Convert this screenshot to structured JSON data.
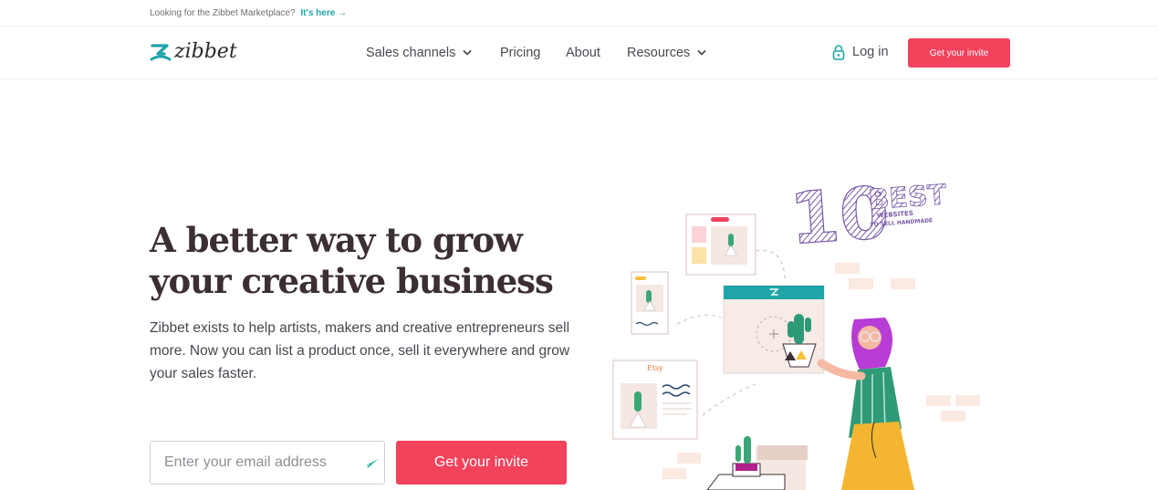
{
  "topbar": {
    "message": "Looking for the Zibbet Marketplace?",
    "link_label": "It's here →"
  },
  "header": {
    "logo_text": "zibbet",
    "nav": [
      {
        "label": "Sales channels",
        "has_dropdown": true
      },
      {
        "label": "Pricing",
        "has_dropdown": false
      },
      {
        "label": "About",
        "has_dropdown": false
      },
      {
        "label": "Resources",
        "has_dropdown": true
      }
    ],
    "login_label": "Log in",
    "cta_label": "Get your invite"
  },
  "hero": {
    "headline": "A better way to grow your creative business",
    "description": "Zibbet exists to help artists, makers and creative entrepreneurs sell more. Now you can list a product once, sell it everywhere and grow your sales faster.",
    "email_placeholder": "Enter your email address",
    "cta_label": "Get your invite"
  },
  "illustration": {
    "badge_number": "10",
    "badge_word": "BEST",
    "badge_line1": "WEBSITES",
    "badge_line2": "TO SELL HANDMADE",
    "card_label": "Etsy"
  },
  "colors": {
    "brand_red": "#f2425c",
    "brand_teal": "#1fa5a8",
    "headline": "#3b2e35"
  }
}
